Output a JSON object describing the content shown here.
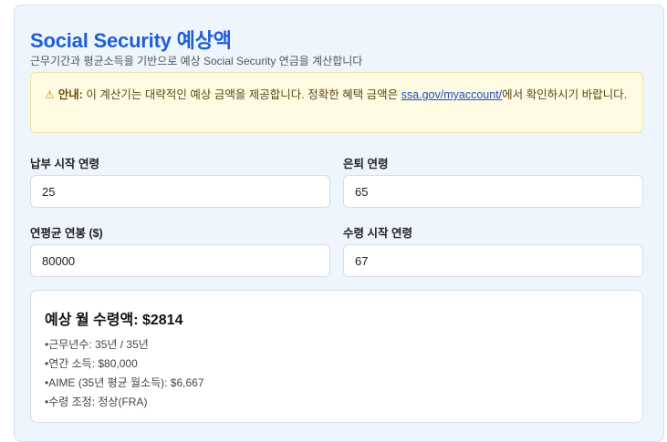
{
  "header": {
    "title": "Social Security 예상액",
    "subtitle": "근무기간과 평균소득을 기반으로 예상 Social Security 연금을 계산합니다"
  },
  "notice": {
    "icon": "warning-icon",
    "lead": "안내:",
    "text_before": "이 계산기는 대략적인 예상 금액을 제공합니다. 정확한 혜택 금액은",
    "link": "ssa.gov/myaccount/",
    "text_after": "에서 확인하시기 바랍니다."
  },
  "form": {
    "start_age": {
      "label": "납부 시작 연령",
      "value": "25"
    },
    "retire_age": {
      "label": "은퇴 연령",
      "value": "65"
    },
    "salary": {
      "label": "연평균 연봉 ($)",
      "value": "80000"
    },
    "claim_age": {
      "label": "수령 시작 연령",
      "value": "67"
    }
  },
  "result": {
    "heading": "예상 월 수령액: $2814",
    "items": [
      "근무년수: 35년 / 35년",
      "연간 소득: $80,000",
      "AIME (35년 평균 월소득): $6,667",
      "수령 조정: 정상(FRA)"
    ]
  },
  "colors": {
    "accent": "#1f5ed4",
    "panel_bg": "#eef5fd",
    "notice_bg": "#fffbe3",
    "link": "#1a4fc4"
  }
}
